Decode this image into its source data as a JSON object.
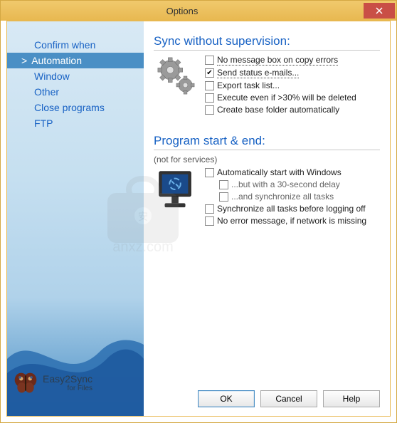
{
  "window": {
    "title": "Options"
  },
  "sidebar": {
    "items": [
      {
        "label": "Confirm when"
      },
      {
        "label": "Automation"
      },
      {
        "label": "Window"
      },
      {
        "label": "Other"
      },
      {
        "label": "Close programs"
      },
      {
        "label": "FTP"
      }
    ],
    "selectedIndex": 1
  },
  "logo": {
    "main": "Easy2Sync",
    "sub": "for Files"
  },
  "sections": {
    "sync": {
      "title": "Sync without supervision:",
      "options": [
        {
          "label": "No message box on copy errors",
          "checked": false,
          "dotted": true
        },
        {
          "label": "Send status e-mails...",
          "checked": true,
          "dotted": true
        },
        {
          "label": "Export task list...",
          "checked": false,
          "dotted": false
        },
        {
          "label": "Execute even if >30% will be deleted",
          "checked": false,
          "dotted": false
        },
        {
          "label": "Create base folder automatically",
          "checked": false,
          "dotted": false
        }
      ]
    },
    "startend": {
      "title": "Program start & end:",
      "subtitle": "(not for services)",
      "options": [
        {
          "label": "Automatically start with Windows",
          "checked": false,
          "sub": false
        },
        {
          "label": "...but with a 30-second delay",
          "checked": false,
          "sub": true
        },
        {
          "label": "...and synchronize all tasks",
          "checked": false,
          "sub": true
        },
        {
          "label": "Synchronize all tasks before logging off",
          "checked": false,
          "sub": false
        },
        {
          "label": "No error message, if network is missing",
          "checked": false,
          "sub": false
        }
      ]
    }
  },
  "buttons": {
    "ok": "OK",
    "cancel": "Cancel",
    "help": "Help"
  }
}
